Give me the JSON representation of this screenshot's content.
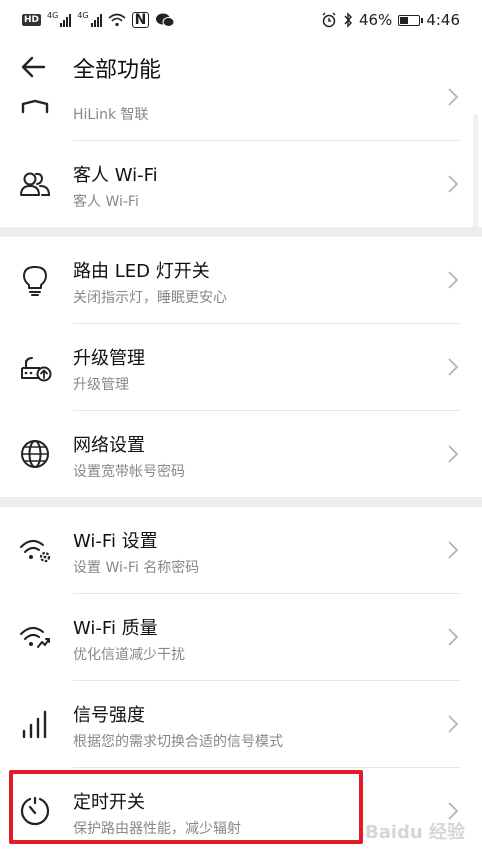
{
  "status_bar": {
    "left_badge": "HD",
    "net1": "4G",
    "net2": "4G",
    "nfc": "N",
    "battery_percent": "46%",
    "battery_level": 0.46,
    "time": "4:46"
  },
  "header": {
    "title": "全部功能"
  },
  "items": [
    {
      "title": "",
      "subtitle": "HiLink 智联",
      "icon": "hilink-icon"
    },
    {
      "title": "客人 Wi-Fi",
      "subtitle": "客人 Wi-Fi",
      "icon": "guest-users-icon"
    },
    {
      "title": "路由 LED 灯开关",
      "subtitle": "关闭指示灯，睡眠更安心",
      "icon": "lightbulb-icon"
    },
    {
      "title": "升级管理",
      "subtitle": "升级管理",
      "icon": "router-upgrade-icon"
    },
    {
      "title": "网络设置",
      "subtitle": "设置宽带帐号密码",
      "icon": "globe-icon"
    },
    {
      "title": "Wi-Fi 设置",
      "subtitle": "设置 Wi-Fi 名称密码",
      "icon": "wifi-settings-icon"
    },
    {
      "title": "Wi-Fi 质量",
      "subtitle": "优化信道减少干扰",
      "icon": "wifi-quality-icon"
    },
    {
      "title": "信号强度",
      "subtitle": "根据您的需求切换合适的信号模式",
      "icon": "signal-strength-icon"
    },
    {
      "title": "定时开关",
      "subtitle": "保护路由器性能，减少辐射",
      "icon": "timer-icon"
    }
  ],
  "watermark": "Baidu 经验"
}
